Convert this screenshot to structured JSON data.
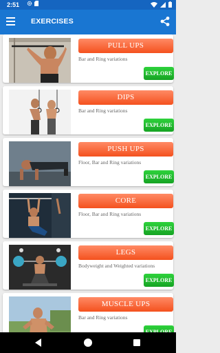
{
  "status_bar": {
    "time": "2:51",
    "icons": [
      "settings-icon",
      "sim-card-icon",
      "wifi-icon",
      "signal-icon",
      "battery-icon"
    ]
  },
  "app_bar": {
    "title": "EXERCISES",
    "icons": [
      "menu-icon",
      "share-icon"
    ]
  },
  "exercises": [
    {
      "title": "PULL UPS",
      "subtitle": "Bar and Ring variations",
      "button": "EXPLORE"
    },
    {
      "title": "DIPS",
      "subtitle": "Bar and Ring variations",
      "button": "EXPLORE"
    },
    {
      "title": "PUSH UPS",
      "subtitle": "Floor, Bar and Ring variations",
      "button": "EXPLORE"
    },
    {
      "title": "CORE",
      "subtitle": "Floor, Bar and Ring variations",
      "button": "EXPLORE"
    },
    {
      "title": "LEGS",
      "subtitle": "Bodyweight and Weighted variations",
      "button": "EXPLORE"
    },
    {
      "title": "MUSCLE UPS",
      "subtitle": "Bar and Ring variations",
      "button": "EXPLORE"
    }
  ],
  "colors": {
    "app_bar": "#1976d2",
    "status_bar": "#1565c0",
    "title_pill": "#f4511e",
    "explore_button": "#1fbf2e",
    "background": "#ececec"
  },
  "nav_bar": {
    "icons": [
      "back-icon",
      "home-icon",
      "recents-icon"
    ]
  }
}
